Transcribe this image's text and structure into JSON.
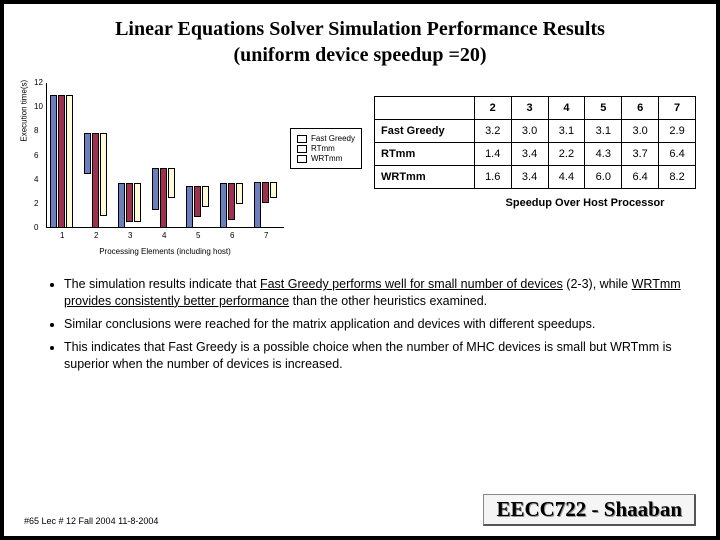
{
  "title_line1": "Linear Equations Solver  Simulation Performance Results",
  "title_line2": "(uniform device speedup =20)",
  "chart_data": {
    "type": "bar",
    "xlabel": "Processing Elements (including host)",
    "ylabel": "Execution time(s)",
    "ylim": [
      0,
      12
    ],
    "yticks": [
      0,
      2,
      4,
      6,
      8,
      10,
      12
    ],
    "categories": [
      "1",
      "2",
      "3",
      "4",
      "5",
      "6",
      "7"
    ],
    "series": [
      {
        "name": "Fast Greedy",
        "values": [
          11,
          3.4,
          3.7,
          3.5,
          3.5,
          3.7,
          3.8
        ]
      },
      {
        "name": "RTmm",
        "values": [
          11,
          7.9,
          3.2,
          5.0,
          2.6,
          3.0,
          1.7
        ]
      },
      {
        "name": "WRTmm",
        "values": [
          11,
          6.9,
          3.2,
          2.5,
          1.8,
          1.7,
          1.3
        ]
      }
    ],
    "legend": [
      "Fast Greedy",
      "RTmm",
      "WRTmm"
    ]
  },
  "table": {
    "headers": [
      "",
      "2",
      "3",
      "4",
      "5",
      "6",
      "7"
    ],
    "rows": [
      {
        "label": "Fast Greedy",
        "cells": [
          "3.2",
          "3.0",
          "3.1",
          "3.1",
          "3.0",
          "2.9"
        ]
      },
      {
        "label": "RTmm",
        "cells": [
          "1.4",
          "3.4",
          "2.2",
          "4.3",
          "3.7",
          "6.4"
        ]
      },
      {
        "label": "WRTmm",
        "cells": [
          "1.6",
          "3.4",
          "4.4",
          "6.0",
          "6.4",
          "8.2"
        ]
      }
    ],
    "caption": "Speedup Over Host Processor"
  },
  "bullets": [
    {
      "pre": "The simulation results  indicate that ",
      "u1": "Fast Greedy performs well for small number of devices",
      "mid": "  (2-3),  while ",
      "u2": "WRTmm provides consistently better performance",
      "post": " than the other heuristics examined."
    },
    {
      "text": "Similar conclusions were reached for the matrix application and devices with different speedups."
    },
    {
      "text": "This indicates that Fast Greedy is a possible choice when the number of MHC devices is small but WRTmm is superior when the number of devices is increased."
    }
  ],
  "footer": {
    "course": "EECC722 - Shaaban",
    "info": "#65   Lec # 12   Fall 2004  11-8-2004"
  }
}
